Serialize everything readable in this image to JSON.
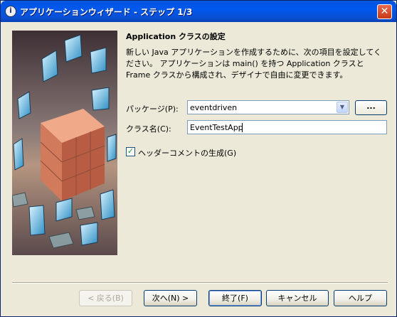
{
  "window": {
    "title": "アプリケーションウィザード - ステップ 1/3",
    "app_icon": "info-circle-icon",
    "close_glyph": "✕"
  },
  "main": {
    "heading": "Application クラスの設定",
    "description": "新しい Java アプリケーションを作成するために、次の項目を設定してください。 アプリケーションは main() を持つ Application クラスと Frame クラスから構成され、デザイナで自由に変更できます。",
    "package_label": "パッケージ(P):",
    "package_value": "eventdriven",
    "browse_label": "...",
    "class_label": "クラス名(C):",
    "class_value": "EventTestApp",
    "header_comment_label": "ヘッダーコメントの生成(G)",
    "header_comment_checked": true
  },
  "buttons": {
    "back": "< 戻る(B)",
    "next": "次へ(N) >",
    "finish": "終了(F)",
    "cancel": "キャンセル",
    "help": "ヘルプ"
  }
}
